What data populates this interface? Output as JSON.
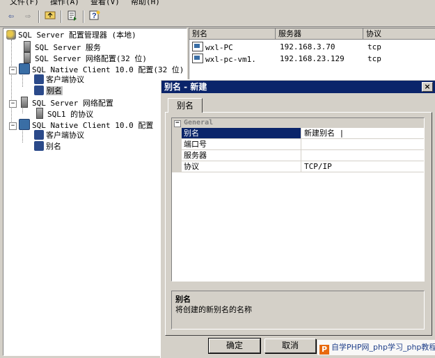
{
  "menubar": {
    "items": [
      "文件(F)",
      "操作(A)",
      "查看(V)",
      "帮助(H)"
    ]
  },
  "toolbar": {
    "back": "back-arrow",
    "forward": "forward-arrow",
    "up": "up-folder",
    "export": "export-list",
    "help": "help"
  },
  "tree": {
    "root": "SQL Server 配置管理器 (本地)",
    "items": [
      "SQL Server 服务",
      "SQL Server 网络配置(32 位)",
      "SQL Native Client 10.0 配置(32 位)",
      "客户端协议",
      "别名",
      "SQL Server 网络配置",
      "SQL1 的协议",
      "SQL Native Client 10.0 配置",
      "客户端协议",
      "别名"
    ]
  },
  "list": {
    "columns": [
      "别名",
      "服务器",
      "协议"
    ],
    "rows": [
      {
        "alias": "wxl-PC",
        "server": "192.168.3.70",
        "protocol": "tcp"
      },
      {
        "alias": "wxl-pc-vm1.",
        "server": "192.168.23.129",
        "protocol": "tcp"
      }
    ]
  },
  "dialog": {
    "title": "别名 - 新建",
    "close": "×",
    "tab": "别名",
    "category": "General",
    "props": [
      {
        "name": "别名",
        "value": "新建别名 |"
      },
      {
        "name": "端口号",
        "value": ""
      },
      {
        "name": "服务器",
        "value": ""
      },
      {
        "name": "协议",
        "value": "TCP/IP"
      }
    ],
    "desc_title": "别名",
    "desc_text": "将创建的新别名的名称",
    "ok": "确定",
    "cancel": "取消"
  },
  "watermark": {
    "icon": "P",
    "text": "自学PHP网_php学习_php教程"
  }
}
